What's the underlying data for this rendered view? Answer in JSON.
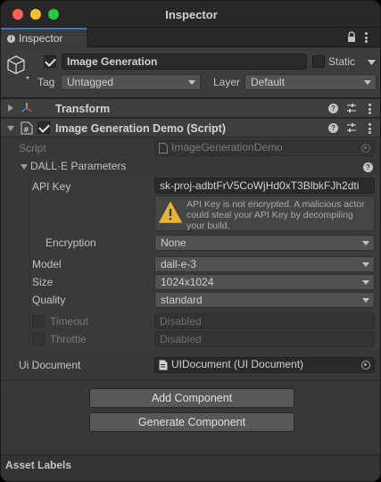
{
  "window": {
    "title": "Inspector"
  },
  "tab": {
    "label": "Inspector"
  },
  "gameobject": {
    "active": true,
    "name": "Image Generation",
    "static_label": "Static",
    "static": false,
    "tag_label": "Tag",
    "tag": "Untagged",
    "layer_label": "Layer",
    "layer": "Default"
  },
  "transform": {
    "title": "Transform",
    "expanded": false
  },
  "script_component": {
    "title": "Image Generation Demo (Script)",
    "enabled": true,
    "expanded": true,
    "script_label": "Script",
    "script_value": "ImageGenerationDemo"
  },
  "dalle": {
    "section_label": "DALL·E Parameters",
    "api_key_label": "API Key",
    "api_key_value": "sk-proj-adbtFrV5CoWjHd0xT3BlbkFJh2dti",
    "warning": "API Key is not encrypted. A malicious actor could steal your API Key by decompiling your build.",
    "encryption_label": "Encryption",
    "encryption_value": "None",
    "model_label": "Model",
    "model_value": "dall-e-3",
    "size_label": "Size",
    "size_value": "1024x1024",
    "quality_label": "Quality",
    "quality_value": "standard",
    "timeout_label": "Timeout",
    "timeout_value": "Disabled",
    "throttle_label": "Throttle",
    "throttle_value": "Disabled"
  },
  "ui_document": {
    "label": "Ui Document",
    "value": "UIDocument (UI Document)"
  },
  "buttons": {
    "add_component": "Add Component",
    "generate_component": "Generate Component"
  },
  "asset_labels": {
    "label": "Asset Labels"
  },
  "colors": {
    "accent": "#3a79bb",
    "background": "#383838",
    "warning": "#e9b336"
  }
}
